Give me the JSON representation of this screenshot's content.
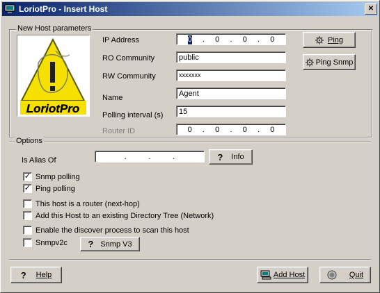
{
  "window": {
    "title": "LoriotPro - Insert Host"
  },
  "host_params": {
    "legend": "New Host parameters",
    "ip_label": "IP Address",
    "ip_octets": [
      "0",
      "0",
      "0",
      "0"
    ],
    "ip_dots": [
      ".",
      ".",
      "."
    ],
    "ro_label": "RO Community",
    "ro_value": "public",
    "rw_label": "RW Community",
    "rw_value": "xxxxxxx",
    "name_label": "Name",
    "name_value": "Agent",
    "poll_label": "Polling interval (s)",
    "poll_value": "15",
    "router_label": "Router ID",
    "router_octets": [
      "0",
      "0",
      "0",
      "0"
    ],
    "ping_label": "Ping",
    "ping_snmp_label": "Ping Snmp",
    "logo_text": "LoriotPro"
  },
  "options": {
    "legend": "Options",
    "alias_label": "Is Alias Of",
    "alias_dots": [
      ".",
      ".",
      "."
    ],
    "info_label": "Info",
    "snmp_polling": {
      "label": "Snmp polling",
      "checked": true
    },
    "ping_polling": {
      "label": "Ping polling",
      "checked": true
    },
    "router": {
      "label": "This host is a router (next-hop)",
      "checked": false
    },
    "add_tree": {
      "label": "Add this Host to an existing Directory Tree (Network)",
      "checked": false
    },
    "discover": {
      "label": "Enable the discover process to scan this host",
      "checked": false
    },
    "snmpv2c": {
      "label": "Snmpv2c",
      "checked": false
    },
    "snmpv3_label": "Snmp V3"
  },
  "footer": {
    "help_label": "Help",
    "add_host_label": "Add Host",
    "quit_label": "Quit"
  }
}
